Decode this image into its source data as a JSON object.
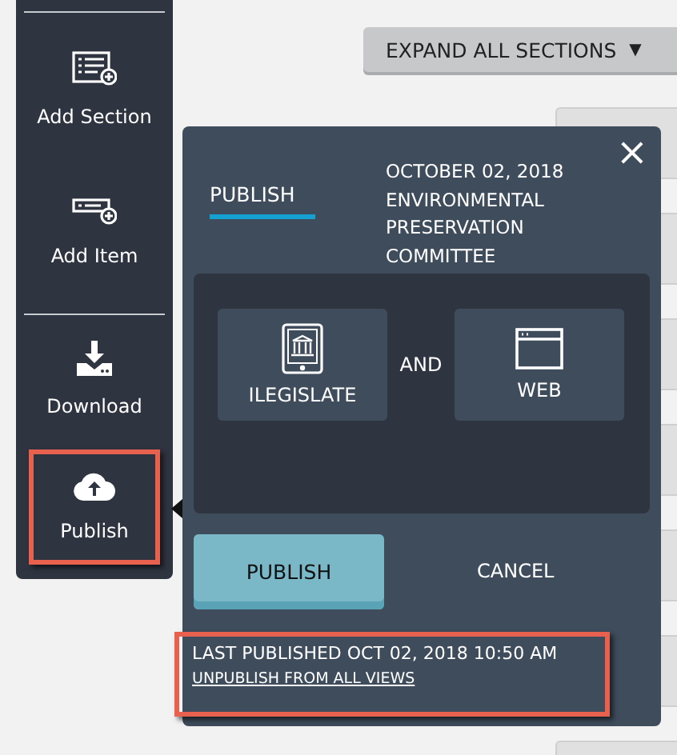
{
  "sidebar": {
    "items": [
      {
        "kind": "section",
        "label": "Add Section",
        "highlighted": false
      },
      {
        "kind": "item",
        "label": "Add Item",
        "highlighted": false
      },
      {
        "kind": "download",
        "label": "Download",
        "highlighted": false
      },
      {
        "kind": "publish",
        "label": "Publish",
        "highlighted": true
      }
    ]
  },
  "expand_button": {
    "label": "EXPAND ALL SECTIONS",
    "caret": "▼"
  },
  "dialog": {
    "close": "×",
    "tabs": [
      {
        "label": "PUBLISH",
        "selected": true
      }
    ],
    "meeting_lines": [
      "OCTOBER 02, 2018",
      "ENVIRONMENTAL",
      "PRESERVATION",
      "COMMITTEE"
    ],
    "targets": [
      {
        "kind": "tablet",
        "label": "ILEGISLATE"
      },
      {
        "kind": "web",
        "label": "WEB"
      }
    ],
    "joiner": "AND",
    "buttons": [
      {
        "kind": "primary",
        "label": "PUBLISH"
      },
      {
        "kind": "plain",
        "label": "CANCEL"
      }
    ],
    "footer": {
      "highlighted": true,
      "status": "LAST PUBLISHED OCT 02, 2018 10:50 AM",
      "link": "UNPUBLISH FROM ALL VIEWS"
    }
  }
}
